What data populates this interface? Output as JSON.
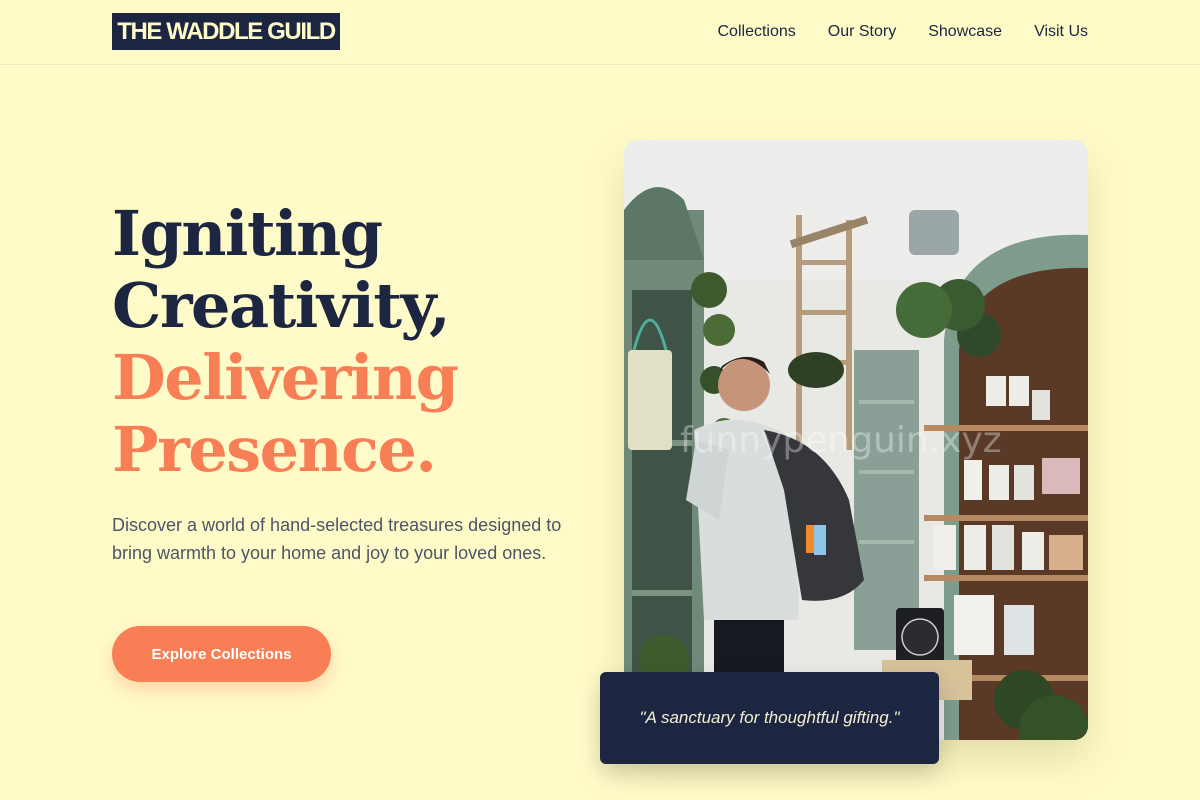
{
  "brand": {
    "name": "THE WADDLE GUILD"
  },
  "nav": {
    "items": [
      {
        "label": "Collections"
      },
      {
        "label": "Our Story"
      },
      {
        "label": "Showcase"
      },
      {
        "label": "Visit Us"
      }
    ]
  },
  "hero": {
    "title_line1": "Igniting",
    "title_line2": "Creativity,",
    "title_line3": "Delivering",
    "title_line4": "Presence.",
    "lead": "Discover a world of hand-selected treasures designed to bring warmth to your home and joy to your loved ones.",
    "cta_label": "Explore Collections"
  },
  "photo": {
    "watermark": "funnypenguin.xyz",
    "quote": "\"A sanctuary for thoughtful gifting.\""
  },
  "colors": {
    "background": "#fffbc9",
    "navy": "#1c2640",
    "accent": "#f77e55"
  }
}
